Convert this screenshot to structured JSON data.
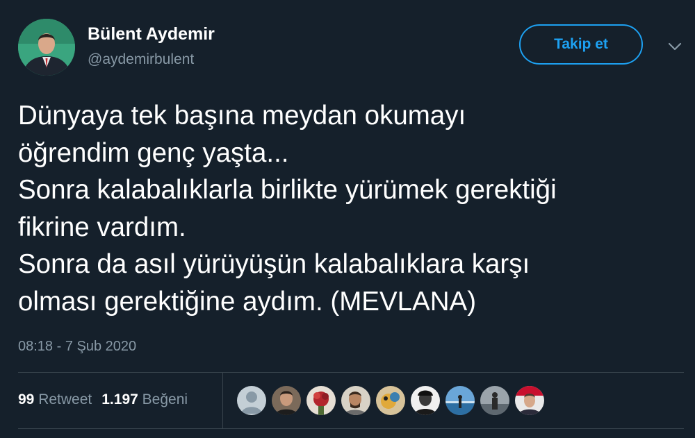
{
  "author": {
    "name": "Bülent Aydemir",
    "handle": "@aydemirbulent"
  },
  "follow_button": {
    "label": "Takip et"
  },
  "tweet": {
    "lines": [
      "Dünyaya tek başına meydan okumayı",
      "öğrendim genç yaşta...",
      "Sonra kalabalıklarla birlikte yürümek gerektiği",
      "fikrine vardım.",
      "Sonra da asıl yürüyüşün kalabalıklara karşı",
      "olması gerektiğine aydım. (MEVLANA)"
    ],
    "timestamp": "08:18 - 7 Şub 2020"
  },
  "stats": {
    "retweets_count": "99",
    "retweets_label": "Retweet",
    "likes_count": "1.197",
    "likes_label": "Beğeni"
  },
  "icons": {
    "more": "chevron-down-icon",
    "default_avatar": "default-user-icon"
  },
  "colors": {
    "background": "#15202b",
    "accent": "#1da1f2",
    "text_primary": "#ffffff",
    "text_secondary": "#8899a6",
    "divider": "#38444d"
  }
}
